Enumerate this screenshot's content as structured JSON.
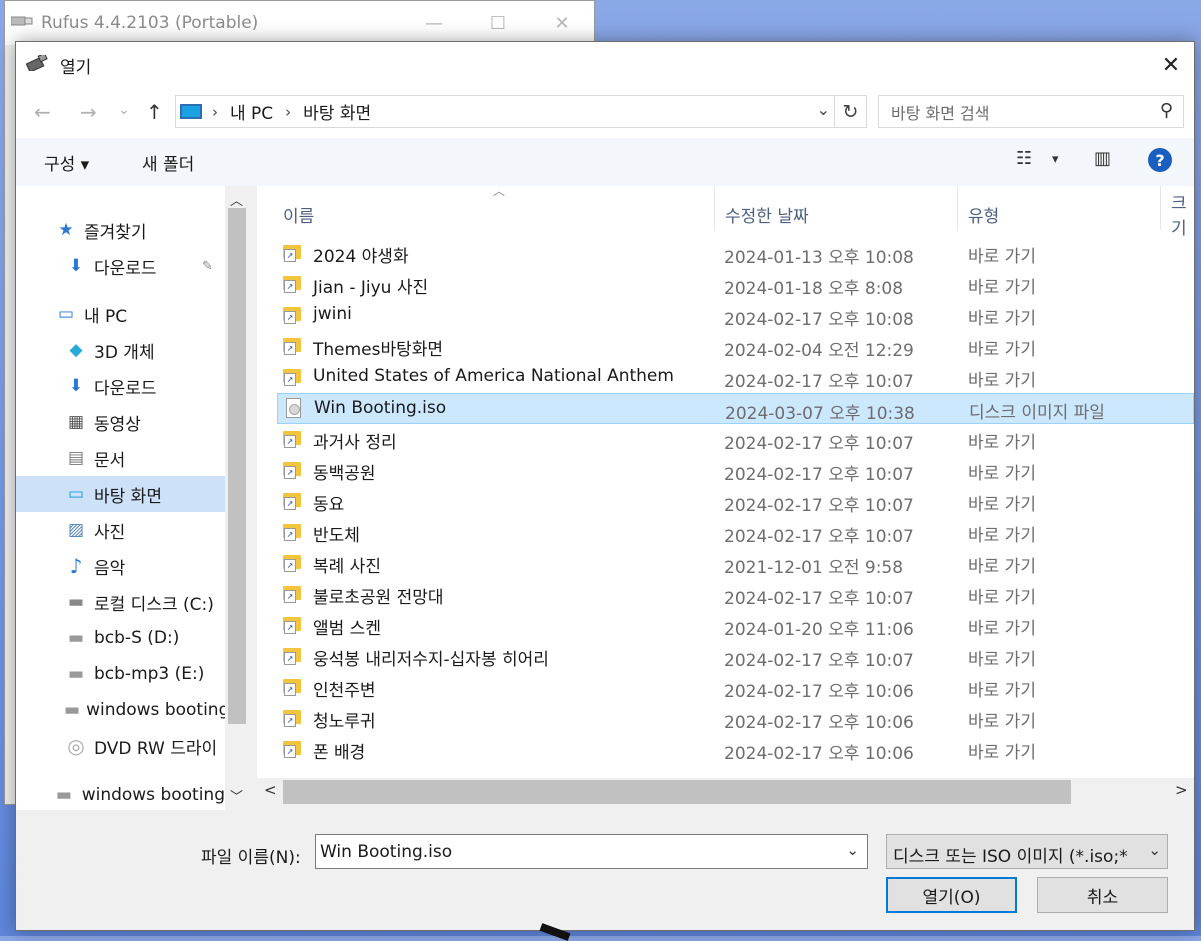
{
  "background_window": {
    "title": "Rufus 4.4.2103 (Portable)",
    "controls": [
      "—",
      "☐",
      "✕"
    ]
  },
  "dialog": {
    "title": "열기",
    "close_label": "✕"
  },
  "navigation": {
    "back": "←",
    "forward": "→",
    "recent": "⌄",
    "up": "↑",
    "breadcrumb": [
      "내 PC",
      "바탕 화면"
    ],
    "refresh": "↻",
    "search_placeholder": "바탕 화면 검색"
  },
  "toolbar": {
    "organize": "구성 ▾",
    "new_folder": "새 폴더",
    "view_menu": "▾"
  },
  "nav_pane": {
    "items": [
      {
        "label": "즐겨찾기",
        "icon": "star-icon",
        "glyph": "★"
      },
      {
        "label": "다운로드",
        "icon": "download-icon",
        "glyph": "⬇"
      },
      {
        "label": "내 PC",
        "icon": "pc-icon",
        "glyph": "🖥"
      },
      {
        "label": "3D 개체",
        "icon": "3d-objects-icon",
        "glyph": "◆"
      },
      {
        "label": "다운로드",
        "icon": "download-icon",
        "glyph": "⬇"
      },
      {
        "label": "동영상",
        "icon": "video-icon",
        "glyph": "▦"
      },
      {
        "label": "문서",
        "icon": "document-icon",
        "glyph": "▤"
      },
      {
        "label": "바탕 화면",
        "icon": "desktop-icon",
        "glyph": "▭"
      },
      {
        "label": "사진",
        "icon": "picture-icon",
        "glyph": "▨"
      },
      {
        "label": "음악",
        "icon": "music-icon",
        "glyph": "♪"
      },
      {
        "label": "로컬 디스크 (C:)",
        "icon": "local-disk-icon",
        "glyph": "▬"
      },
      {
        "label": "bcb-S (D:)",
        "icon": "drive-icon",
        "glyph": "▬"
      },
      {
        "label": "bcb-mp3 (E:)",
        "icon": "drive-icon",
        "glyph": "▬"
      },
      {
        "label": "windows booting",
        "icon": "drive-icon",
        "glyph": "▬"
      },
      {
        "label": "DVD RW 드라이",
        "icon": "dvd-icon",
        "glyph": "◎"
      },
      {
        "label": "windows booting",
        "icon": "drive-icon",
        "glyph": "▬"
      }
    ],
    "pin_glyph": "📌"
  },
  "columns": {
    "name": "이름",
    "modified": "수정한 날짜",
    "type": "유형",
    "size": "크기"
  },
  "files": [
    {
      "name": "2024 야생화",
      "date": "2024-01-13 오후 10:08",
      "type": "바로 가기",
      "kind": "folder-shortcut"
    },
    {
      "name": "Jian - Jiyu 사진",
      "date": "2024-01-18 오후 8:08",
      "type": "바로 가기",
      "kind": "folder-shortcut"
    },
    {
      "name": "jwini",
      "date": "2024-02-17 오후 10:08",
      "type": "바로 가기",
      "kind": "folder-shortcut"
    },
    {
      "name": "Themes바탕화면",
      "date": "2024-02-04 오전 12:29",
      "type": "바로 가기",
      "kind": "folder-shortcut"
    },
    {
      "name": "United States of America National Anthem",
      "date": "2024-02-17 오후 10:07",
      "type": "바로 가기",
      "kind": "folder-shortcut"
    },
    {
      "name": "Win Booting.iso",
      "date": "2024-03-07 오후 10:38",
      "type": "디스크 이미지 파일",
      "kind": "iso"
    },
    {
      "name": "과거사 정리",
      "date": "2024-02-17 오후 10:07",
      "type": "바로 가기",
      "kind": "folder-shortcut"
    },
    {
      "name": "동백공원",
      "date": "2024-02-17 오후 10:07",
      "type": "바로 가기",
      "kind": "folder-shortcut"
    },
    {
      "name": "동요",
      "date": "2024-02-17 오후 10:07",
      "type": "바로 가기",
      "kind": "folder-shortcut"
    },
    {
      "name": "반도체",
      "date": "2024-02-17 오후 10:07",
      "type": "바로 가기",
      "kind": "folder-shortcut"
    },
    {
      "name": "복례 사진",
      "date": "2021-12-01 오전 9:58",
      "type": "바로 가기",
      "kind": "folder-shortcut"
    },
    {
      "name": "불로초공원 전망대",
      "date": "2024-02-17 오후 10:07",
      "type": "바로 가기",
      "kind": "folder-shortcut"
    },
    {
      "name": "앨범 스켄",
      "date": "2024-01-20 오후 11:06",
      "type": "바로 가기",
      "kind": "folder-shortcut"
    },
    {
      "name": "웅석봉 내리저수지-십자봉 히어리",
      "date": "2024-02-17 오후 10:07",
      "type": "바로 가기",
      "kind": "folder-shortcut"
    },
    {
      "name": "인천주변",
      "date": "2024-02-17 오후 10:06",
      "type": "바로 가기",
      "kind": "folder-shortcut"
    },
    {
      "name": "청노루귀",
      "date": "2024-02-17 오후 10:06",
      "type": "바로 가기",
      "kind": "folder-shortcut"
    },
    {
      "name": "폰 배경",
      "date": "2024-02-17 오후 10:06",
      "type": "바로 가기",
      "kind": "folder-shortcut"
    }
  ],
  "selected_file": "Win Booting.iso",
  "bottom": {
    "filename_label": "파일 이름(N):",
    "filename_value": "Win Booting.iso",
    "filter_value": "디스크 또는 ISO 이미지 (*.iso;*",
    "open_button": "열기(O)",
    "cancel_button": "취소"
  },
  "colors": {
    "accent": "#0078d7",
    "selection": "#cce8ff",
    "nav_selection": "#cde1f8",
    "folder": "#f3c43d"
  }
}
